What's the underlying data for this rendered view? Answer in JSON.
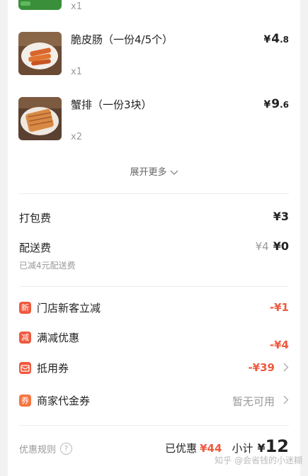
{
  "items": [
    {
      "name": "",
      "qty": "x1"
    },
    {
      "name": "脆皮肠（一份4/5个）",
      "qty": "x1",
      "price_yen": "¥",
      "price_int": "4",
      "price_dec": ".8"
    },
    {
      "name": "蟹排（一份3块）",
      "qty": "x2",
      "price_yen": "¥",
      "price_int": "9",
      "price_dec": ".6"
    }
  ],
  "expand_label": "展开更多",
  "fees": {
    "packing_label": "打包费",
    "packing_value": "¥3",
    "delivery_label": "配送费",
    "delivery_original": "¥4",
    "delivery_value": "¥0",
    "delivery_note": "已减4元配送费"
  },
  "discounts": [
    {
      "icon": "新",
      "label": "门店新客立减",
      "value": "-¥1"
    },
    {
      "icon": "减",
      "label": "满减优惠",
      "value": "-¥4"
    },
    {
      "icon": "",
      "label": "抵用券",
      "value": "-¥39"
    },
    {
      "icon": "券",
      "label": "商家代金券",
      "value": "暂无可用"
    }
  ],
  "footer": {
    "rules_label": "优惠规则",
    "help_glyph": "?",
    "saved_label": "已优惠",
    "saved_value": "¥44",
    "subtotal_label": "小计",
    "subtotal_yen": "¥",
    "subtotal_value": "12"
  },
  "watermark": "知乎 @会省钱的小迷糊"
}
